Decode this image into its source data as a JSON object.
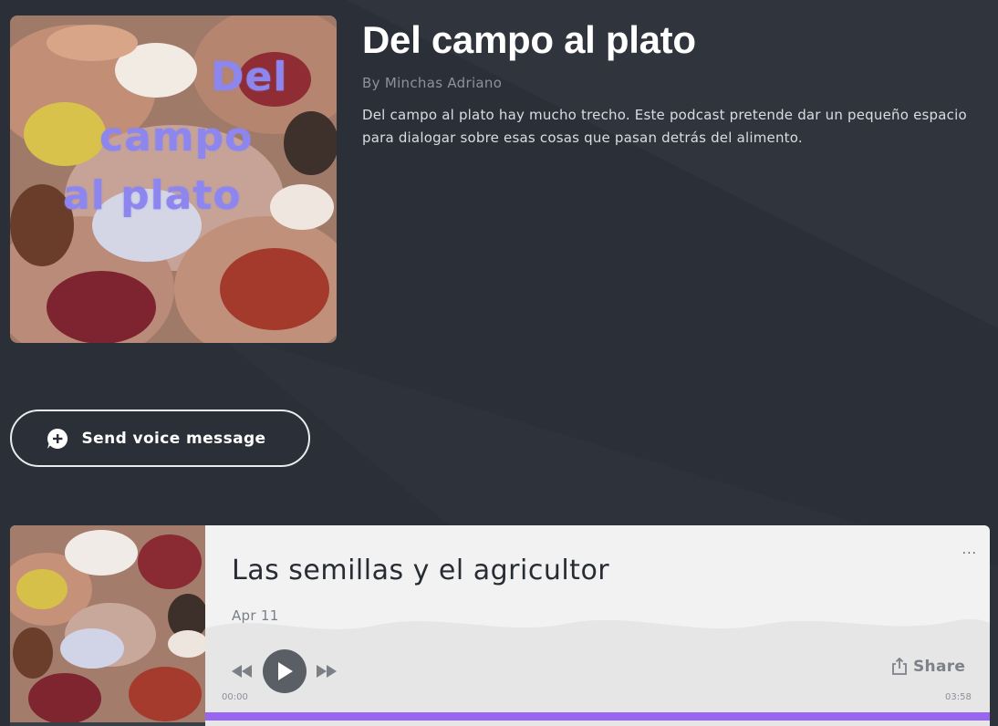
{
  "podcast": {
    "title": "Del campo al plato",
    "author": "By Minchas Adriano",
    "description": "Del campo al plato hay mucho trecho. Este podcast pretende dar un pequeño espacio para dialogar sobre esas cosas que pasan detrás del alimento.",
    "cover_text": [
      "Del",
      "campo",
      "al plato"
    ]
  },
  "voice_message": {
    "label": "Send voice message",
    "icon": "chat-plus-icon"
  },
  "episode": {
    "title": "Las semillas y el agricultor",
    "date": "Apr 11",
    "more_label": "...",
    "share_label": "Share",
    "time_current": "00:00",
    "time_total": "03:58",
    "progress": 0,
    "icons": {
      "rewind": "rewind-icon",
      "play": "play-icon",
      "forward": "fast-forward-icon",
      "share": "share-icon"
    }
  },
  "colors": {
    "background": "#2b3038",
    "accent_purple": "#9966f0",
    "cover_text": "#8c86ee",
    "card": "#f2f2f3"
  }
}
